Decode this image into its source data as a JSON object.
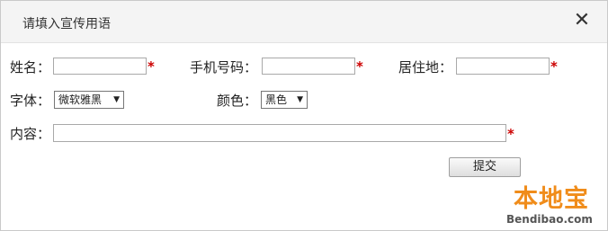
{
  "dialog": {
    "title": "请填入宣传用语",
    "close_glyph": "✕"
  },
  "form": {
    "name_label": "姓名：",
    "name_value": "",
    "phone_label": "手机号码：",
    "phone_value": "",
    "residence_label": "居住地：",
    "residence_value": "",
    "font_label": "字体：",
    "font_selected": "微软雅黑",
    "color_label": "颜色：",
    "color_selected": "黑色",
    "content_label": "内容：",
    "content_value": "",
    "required_mark": "*",
    "select_arrow": "▼",
    "submit_label": "提交"
  },
  "watermark": {
    "brand": "本地宝",
    "url": "Bendibao.com"
  },
  "colors": {
    "required": "#cc0000",
    "watermark": "#f08c1a"
  }
}
